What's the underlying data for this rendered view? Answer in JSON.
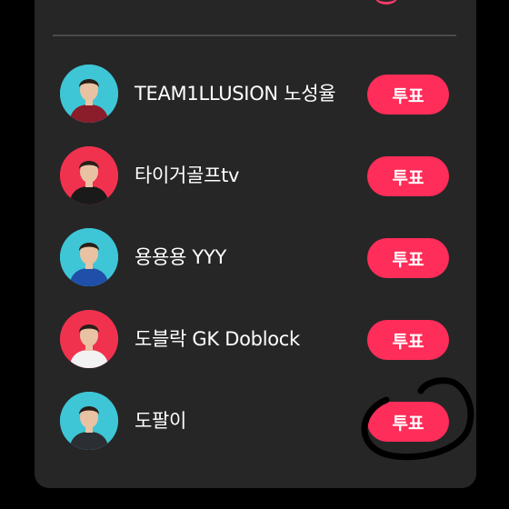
{
  "colors": {
    "background": "#000000",
    "panel": "#262627",
    "accent": "#ff2d59",
    "text": "#ffffff",
    "divider": "#4a4a4c"
  },
  "candidates": [
    {
      "name": "TEAM1LLUSION 노성율",
      "vote_label": "투표",
      "avatar_bg": "#3ec6d6",
      "shirt": "#8b1c2a"
    },
    {
      "name": "타이거골프tv",
      "vote_label": "투표",
      "avatar_bg": "#f0324f",
      "shirt": "#1a1a1a"
    },
    {
      "name": "용용용 YYY",
      "vote_label": "투표",
      "avatar_bg": "#3ec6d6",
      "shirt": "#1f4fa8"
    },
    {
      "name": "도블락 GK Doblock",
      "vote_label": "투표",
      "avatar_bg": "#f0324f",
      "shirt": "#f2f2f2"
    },
    {
      "name": "도팔이",
      "vote_label": "투표",
      "avatar_bg": "#3ec6d6",
      "shirt": "#2b2e33"
    }
  ],
  "annotation": {
    "type": "hand-drawn circle",
    "target": "candidates.4.vote_button",
    "color": "#000000"
  }
}
